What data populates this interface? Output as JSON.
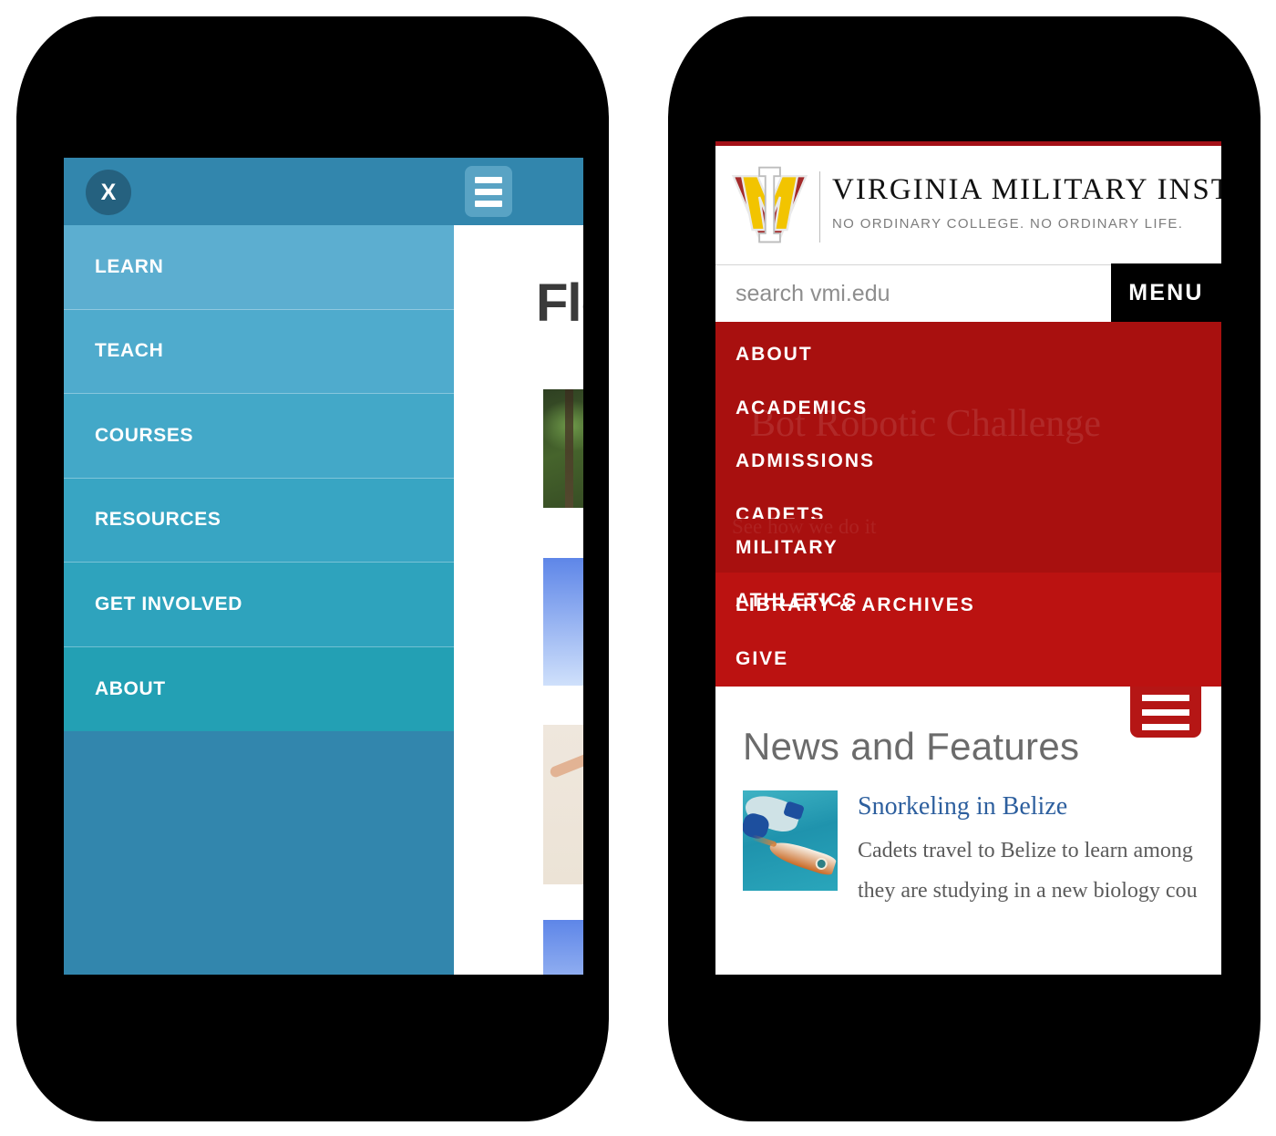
{
  "left_phone": {
    "topbar": {
      "close_label": "X",
      "close_icon": "close-x-icon",
      "menu_icon": "hamburger-menu-icon"
    },
    "nav_items": [
      {
        "label": "LEARN"
      },
      {
        "label": "TEACH"
      },
      {
        "label": "COURSES"
      },
      {
        "label": "RESOURCES"
      },
      {
        "label": "GET INVOLVED"
      },
      {
        "label": "ABOUT"
      }
    ],
    "content": {
      "heading": "Flex",
      "images": [
        {
          "name": "forest-photo"
        },
        {
          "name": "screenshot-thumbnail-1"
        },
        {
          "name": "jumping-woman-photo"
        },
        {
          "name": "screenshot-thumbnail-2"
        }
      ]
    },
    "colors": {
      "topbar": "#3286ad",
      "nav_top": "#5caed0",
      "nav_bottom": "#23a0b4",
      "close_circle": "#25617f",
      "burger_button": "#59a3c4"
    }
  },
  "right_phone": {
    "brand": {
      "logo_icon": "vmi-monogram-logo",
      "wordmark": "VIRGINIA MILITARY INSTITUTE",
      "tagline": "NO ORDINARY COLLEGE. NO ORDINARY LIFE."
    },
    "search": {
      "placeholder": "search vmi.edu",
      "value": ""
    },
    "menu_button": {
      "label": "MENU"
    },
    "nav_items": [
      {
        "label": "ABOUT"
      },
      {
        "label": "ACADEMICS"
      },
      {
        "label": "ADMISSIONS"
      },
      {
        "label": "CADETS"
      },
      {
        "label": "MILITARY"
      },
      {
        "label": "ATHLETICS"
      },
      {
        "label": "LIBRARY & ARCHIVES"
      },
      {
        "label": "GIVE"
      }
    ],
    "background_ghost": {
      "text": "Bot Robotic Challenge",
      "subtext": "See how we do it"
    },
    "news": {
      "section_title": "News and Features",
      "burger_icon": "hamburger-menu-icon",
      "article": {
        "thumbnail_name": "snorkeling-thumbnail",
        "headline": "Snorkeling in Belize",
        "body_line1": "Cadets travel to Belize to learn among",
        "body_line2": "they are studying in a new biology cou"
      }
    },
    "colors": {
      "top_rule": "#a41017",
      "menu_red": "#a8100f",
      "menu_red_light": "#bb1211",
      "burger_red": "#b51615",
      "link_blue": "#2d5f9e",
      "logo_gold": "#f2c400",
      "logo_red": "#a32a2a"
    }
  }
}
